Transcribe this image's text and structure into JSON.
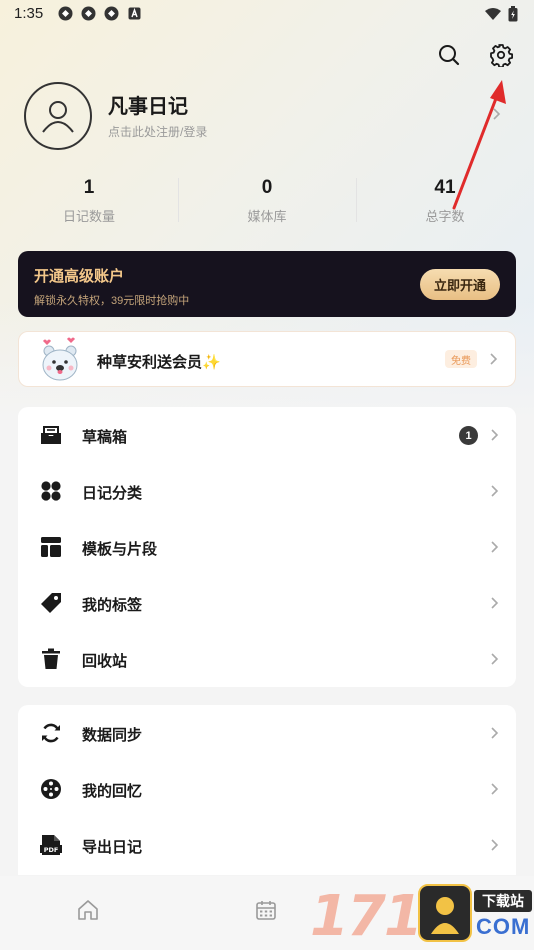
{
  "status_bar": {
    "time": "1:35",
    "left_icons": [
      "app-icon-1",
      "app-icon-2",
      "app-icon-3",
      "a-badge-icon"
    ],
    "right_icons": [
      "wifi-icon",
      "battery-icon"
    ]
  },
  "header": {
    "search_icon": "search-icon",
    "settings_icon": "gear-icon"
  },
  "profile": {
    "name": "凡事日记",
    "subtitle": "点击此处注册/登录"
  },
  "stats": [
    {
      "value": "1",
      "label": "日记数量"
    },
    {
      "value": "0",
      "label": "媒体库"
    },
    {
      "value": "41",
      "label": "总字数"
    }
  ],
  "premium": {
    "title": "开通高级账户",
    "subtitle": "解锁永久特权，39元限时抢购中",
    "button": "立即开通"
  },
  "promo": {
    "title": "种草安利送会员✨",
    "badge": "免费"
  },
  "menu_group_1": [
    {
      "label": "草稿箱",
      "icon": "inbox-icon",
      "count": "1"
    },
    {
      "label": "日记分类",
      "icon": "category-icon"
    },
    {
      "label": "模板与片段",
      "icon": "template-icon"
    },
    {
      "label": "我的标签",
      "icon": "tag-icon"
    },
    {
      "label": "回收站",
      "icon": "trash-icon"
    }
  ],
  "menu_group_2": [
    {
      "label": "数据同步",
      "icon": "sync-icon"
    },
    {
      "label": "我的回忆",
      "icon": "film-reel-icon"
    },
    {
      "label": "导出日记",
      "icon": "pdf-icon"
    }
  ],
  "bottom_nav": [
    "home-icon",
    "calendar-icon"
  ],
  "watermark": {
    "digits": "1717",
    "tag": "下载站",
    "domain": "COM"
  },
  "colors": {
    "premium_bg": "#16121e",
    "premium_gold": "#f3c78a",
    "badge_orange": "#e99755",
    "annotation_red": "#e02b2b"
  }
}
